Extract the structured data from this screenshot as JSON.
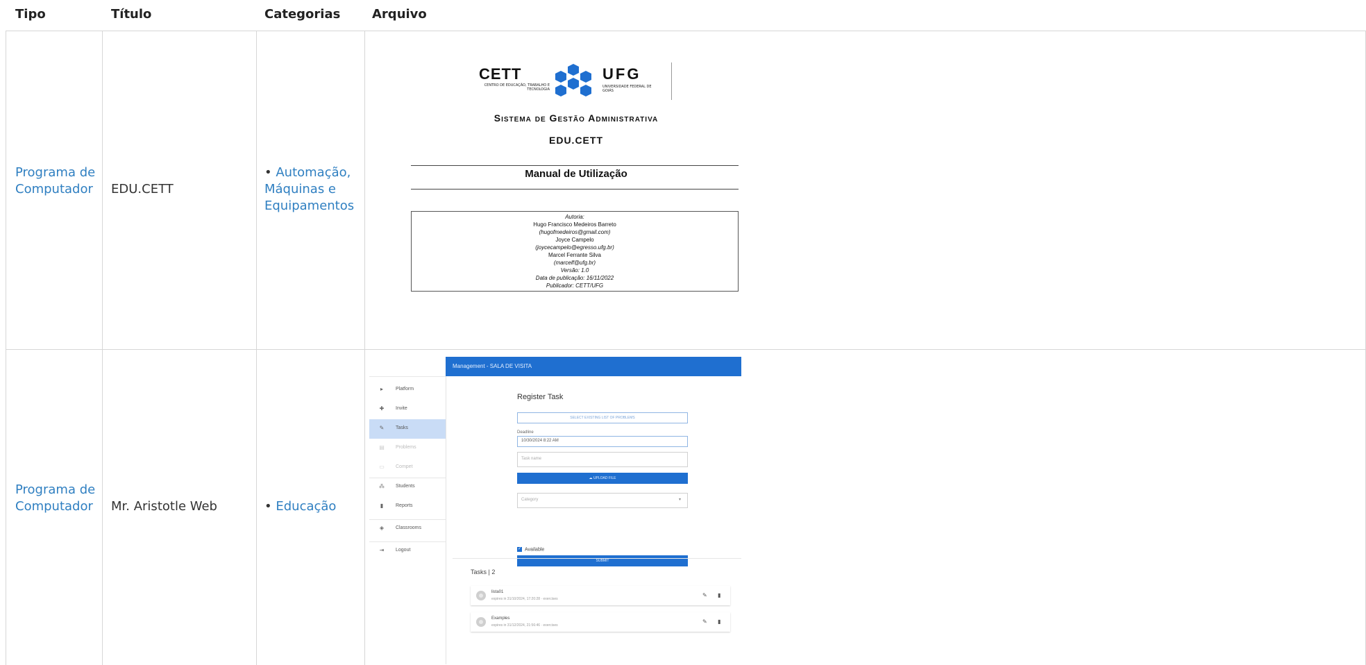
{
  "headers": {
    "tipo": "Tipo",
    "titulo": "Título",
    "categorias": "Categorias",
    "arquivo": "Arquivo"
  },
  "rows": [
    {
      "tipo": "Programa de Computador",
      "titulo": "EDU.CETT",
      "categoria": "Automação, Máquinas e Equipamentos",
      "bullet": "•"
    },
    {
      "tipo": "Programa de Computador",
      "titulo": "Mr. Aristotle Web",
      "categoria": "Educação",
      "bullet": "•"
    }
  ],
  "doc_preview": {
    "cett": "CETT",
    "cett_sub": "CENTRO DE EDUCAÇÃO, TRABALHO E TECNOLOGIA",
    "ufg": "UFG",
    "ufg_sub": "UNIVERSIDADE FEDERAL DE GOIÁS",
    "title": "Sistema de Gestão Administrativa",
    "subtitle": "EDU.CETT",
    "manual": "Manual de Utilização",
    "authors_label": "Autoria:",
    "lines": [
      "Hugo Francisco Medeiros Barreto",
      "(hugofmedeiros@gmail.com)",
      "Joyce Campelo",
      "(joycecampelo@egresso.ufg.br)",
      "Marcel Ferrante Silva",
      "(marcelf@ufg.br)"
    ],
    "version": "Versão: 1.0",
    "date": "Data de publicação: 16/11/2022",
    "publisher": "Publicador: CETT/UFG"
  },
  "app_preview": {
    "topbar_title": "Management - SALA DE VISITA",
    "nav": [
      {
        "icon": "▸",
        "label": "Platform"
      },
      {
        "icon": "✚",
        "label": "Invite"
      },
      {
        "icon": "✎",
        "label": "Tasks"
      },
      {
        "icon": "▤",
        "label": "Problems"
      },
      {
        "icon": "▭",
        "label": "Compet"
      },
      {
        "icon": "⁂",
        "label": "Students"
      },
      {
        "icon": "▮",
        "label": "Reports"
      },
      {
        "icon": "◈",
        "label": "Classrooms"
      },
      {
        "icon": "⇥",
        "label": "Logout"
      }
    ],
    "form_title": "Register Task",
    "select_existing": "SELECT EXISTING LIST OF PROBLEMS",
    "deadline_label": "Deadline",
    "deadline_value": "10/30/2024 8:22 AM",
    "task_name_placeholder": "Task name",
    "upload": "UPLOAD FILE",
    "category_placeholder": "Category",
    "available": "Available",
    "submit": "SUBMIT",
    "tasks_title": "Tasks | 2",
    "tasks": [
      {
        "name": "lista01",
        "sub": "expires in 31/10/2024, 17:20:28 · exercises"
      },
      {
        "name": "Examples",
        "sub": "expires in 31/12/2024, 21:56:46 · exercises"
      }
    ]
  }
}
